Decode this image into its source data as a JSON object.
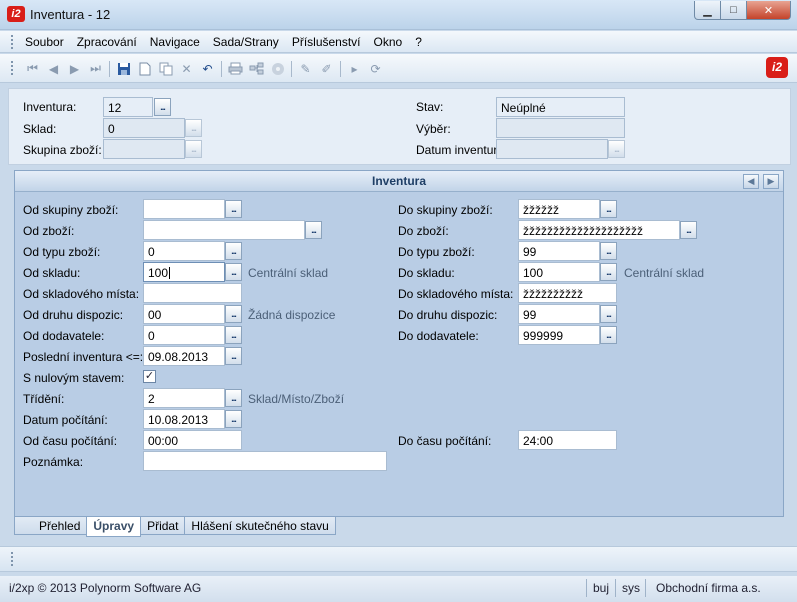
{
  "window": {
    "title": "Inventura - 12",
    "logo": "i2"
  },
  "menu": [
    "Soubor",
    "Zpracování",
    "Navigace",
    "Sada/Strany",
    "Příslušenství",
    "Okno",
    "?"
  ],
  "header": {
    "inventura_label": "Inventura:",
    "inventura_value": "12",
    "sklad_label": "Sklad:",
    "sklad_value": "0",
    "skupina_label": "Skupina zboží:",
    "skupina_value": "",
    "stav_label": "Stav:",
    "stav_value": "Neúplné",
    "vyber_label": "Výběr:",
    "vyber_value": "",
    "datum_label": "Datum inventury:",
    "datum_value": ""
  },
  "panel": {
    "title": "Inventura"
  },
  "form": {
    "od_skupiny_label": "Od skupiny zboží:",
    "od_skupiny_value": "",
    "do_skupiny_label": "Do skupiny zboží:",
    "do_skupiny_value": "žžžžžž",
    "od_zbozi_label": "Od zboží:",
    "od_zbozi_value": "",
    "do_zbozi_label": "Do zboží:",
    "do_zbozi_value": "žžžžžžžžžžžžžžžžžžžž",
    "od_typu_label": "Od typu zboží:",
    "od_typu_value": "0",
    "do_typu_label": "Do typu zboží:",
    "do_typu_value": "99",
    "od_skladu_label": "Od skladu:",
    "od_skladu_value": "100",
    "od_skladu_hint": "Centrální sklad",
    "do_skladu_label": "Do skladu:",
    "do_skladu_value": "100",
    "do_skladu_hint": "Centrální sklad",
    "od_mista_label": "Od skladového místa:",
    "od_mista_value": "",
    "do_mista_label": "Do skladového místa:",
    "do_mista_value": "žžžžžžžžžž",
    "od_druhu_label": "Od druhu dispozic:",
    "od_druhu_value": "00",
    "od_druhu_hint": "Žádná dispozice",
    "do_druhu_label": "Do druhu dispozic:",
    "do_druhu_value": "99",
    "od_dodavatele_label": "Od dodavatele:",
    "od_dodavatele_value": "0",
    "do_dodavatele_label": "Do dodavatele:",
    "do_dodavatele_value": "999999",
    "posledni_label": "Poslední inventura <=:",
    "posledni_value": "09.08.2013",
    "nulovy_label": "S nulovým stavem:",
    "nulovy_checked": "✓",
    "trideni_label": "Třídění:",
    "trideni_value": "2",
    "trideni_hint": "Sklad/Místo/Zboží",
    "datum_pocitani_label": "Datum počítání:",
    "datum_pocitani_value": "10.08.2013",
    "od_casu_label": "Od času počítání:",
    "od_casu_value": "00:00",
    "do_casu_label": "Do času počítání:",
    "do_casu_value": "24:00",
    "poznamka_label": "Poznámka:",
    "poznamka_value": ""
  },
  "tabs": [
    "Přehled",
    "Úpravy",
    "Přidat",
    "Hlášení skutečného stavu"
  ],
  "status": {
    "copyright": "i/2xp © 2013 Polynorm Software AG",
    "user": "buj",
    "db": "sys",
    "firm": "Obchodní firma a.s."
  },
  "buttons": {
    "ellipsis": "..."
  }
}
